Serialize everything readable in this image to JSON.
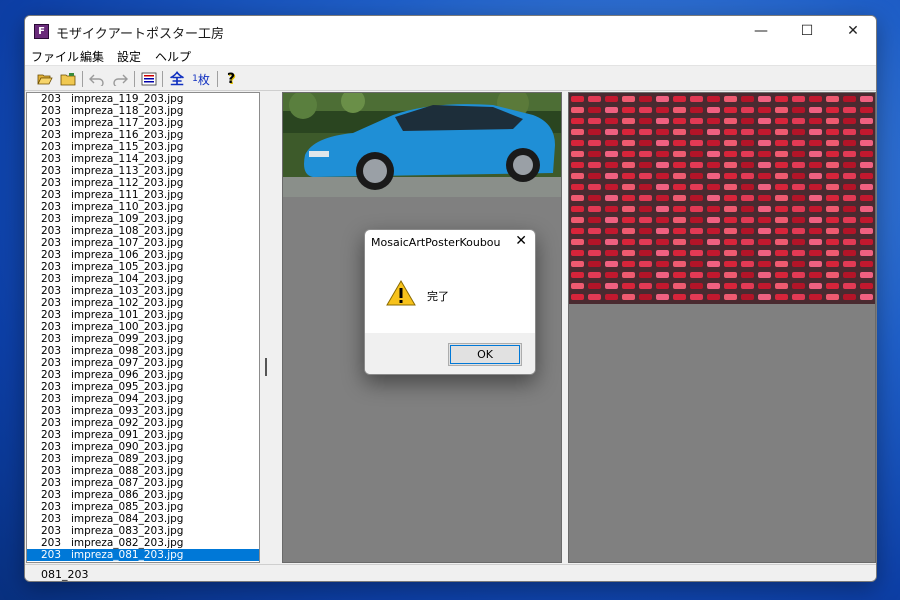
{
  "window": {
    "title": "モザイクアートポスター工房",
    "icon_letter": "F"
  },
  "caption_buttons": {
    "minimize": "—",
    "maximize": "☐",
    "close": "✕"
  },
  "menu": [
    "ファイル",
    "編集",
    "設定",
    "ヘルプ"
  ],
  "toolbar": {
    "all_label": "全",
    "single_label_num": "1",
    "single_label_text": "枚",
    "help_glyph": "?"
  },
  "file_list": {
    "rows": [
      {
        "num": "203",
        "name": "impreza_119_203.jpg"
      },
      {
        "num": "203",
        "name": "impreza_118_203.jpg"
      },
      {
        "num": "203",
        "name": "impreza_117_203.jpg"
      },
      {
        "num": "203",
        "name": "impreza_116_203.jpg"
      },
      {
        "num": "203",
        "name": "impreza_115_203.jpg"
      },
      {
        "num": "203",
        "name": "impreza_114_203.jpg"
      },
      {
        "num": "203",
        "name": "impreza_113_203.jpg"
      },
      {
        "num": "203",
        "name": "impreza_112_203.jpg"
      },
      {
        "num": "203",
        "name": "impreza_111_203.jpg"
      },
      {
        "num": "203",
        "name": "impreza_110_203.jpg"
      },
      {
        "num": "203",
        "name": "impreza_109_203.jpg"
      },
      {
        "num": "203",
        "name": "impreza_108_203.jpg"
      },
      {
        "num": "203",
        "name": "impreza_107_203.jpg"
      },
      {
        "num": "203",
        "name": "impreza_106_203.jpg"
      },
      {
        "num": "203",
        "name": "impreza_105_203.jpg"
      },
      {
        "num": "203",
        "name": "impreza_104_203.jpg"
      },
      {
        "num": "203",
        "name": "impreza_103_203.jpg"
      },
      {
        "num": "203",
        "name": "impreza_102_203.jpg"
      },
      {
        "num": "203",
        "name": "impreza_101_203.jpg"
      },
      {
        "num": "203",
        "name": "impreza_100_203.jpg"
      },
      {
        "num": "203",
        "name": "impreza_099_203.jpg"
      },
      {
        "num": "203",
        "name": "impreza_098_203.jpg"
      },
      {
        "num": "203",
        "name": "impreza_097_203.jpg"
      },
      {
        "num": "203",
        "name": "impreza_096_203.jpg"
      },
      {
        "num": "203",
        "name": "impreza_095_203.jpg"
      },
      {
        "num": "203",
        "name": "impreza_094_203.jpg"
      },
      {
        "num": "203",
        "name": "impreza_093_203.jpg"
      },
      {
        "num": "203",
        "name": "impreza_092_203.jpg"
      },
      {
        "num": "203",
        "name": "impreza_091_203.jpg"
      },
      {
        "num": "203",
        "name": "impreza_090_203.jpg"
      },
      {
        "num": "203",
        "name": "impreza_089_203.jpg"
      },
      {
        "num": "203",
        "name": "impreza_088_203.jpg"
      },
      {
        "num": "203",
        "name": "impreza_087_203.jpg"
      },
      {
        "num": "203",
        "name": "impreza_086_203.jpg"
      },
      {
        "num": "203",
        "name": "impreza_085_203.jpg"
      },
      {
        "num": "203",
        "name": "impreza_084_203.jpg"
      },
      {
        "num": "203",
        "name": "impreza_083_203.jpg"
      },
      {
        "num": "203",
        "name": "impreza_082_203.jpg"
      },
      {
        "num": "203",
        "name": "impreza_081_203.jpg"
      }
    ],
    "selected_index": 38
  },
  "status": "081_203",
  "dialog": {
    "title": "MosaicArtPosterKoubou",
    "close": "✕",
    "message": "完了",
    "ok_label": "OK",
    "icon": "warning-icon"
  },
  "colors": {
    "accent": "#0078d7",
    "pane_bg": "#808080",
    "car_body": "#1f8fd6",
    "mosaic_red": "#d8243a"
  }
}
